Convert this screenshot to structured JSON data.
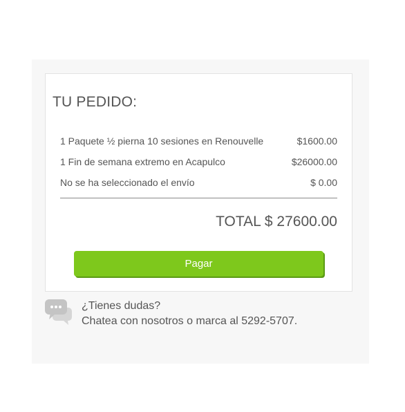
{
  "order": {
    "title": "TU PEDIDO:",
    "items": [
      {
        "name": "1 Paquete ½ pierna 10 sesiones en Renouvelle",
        "price": "$1600.00"
      },
      {
        "name": "1 Fin de semana extremo en Acapulco",
        "price": "$26000.00"
      },
      {
        "name": "No se ha seleccionado el envío",
        "price": "$ 0.00"
      }
    ],
    "total": "TOTAL $ 27600.00",
    "pay_label": "Pagar"
  },
  "help": {
    "icon": "chat-bubbles-icon",
    "question": "¿Tienes dudas?",
    "contact": "Chatea con nosotros o marca al 5292-5707."
  },
  "colors": {
    "accent": "#7ec81c",
    "accent_shadow": "#5a9a14",
    "panel_bg": "#f7f7f7",
    "text": "#555555",
    "icon": "#cccccc"
  }
}
